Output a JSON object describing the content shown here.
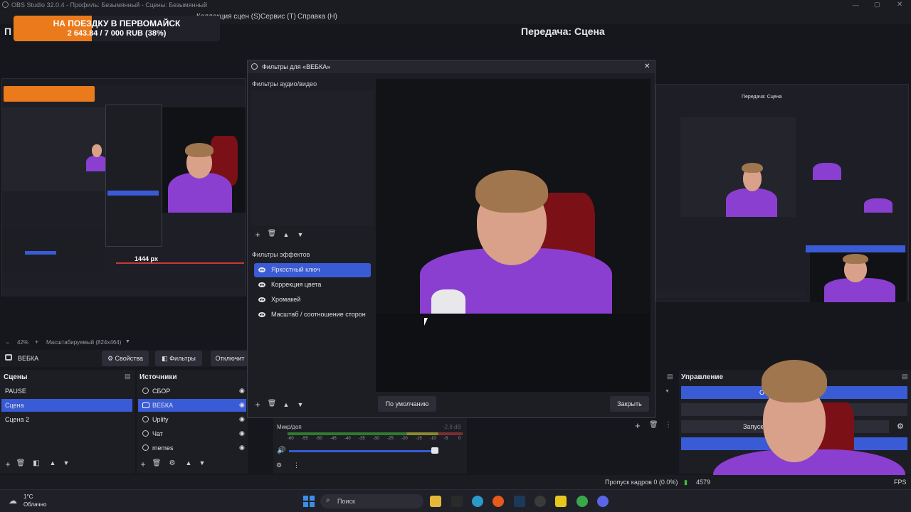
{
  "window": {
    "title": "OBS Studio 32.0.4 - Профиль: Безымянный - Сцены: Безымянный"
  },
  "menu": {
    "scenes_collection": "Коллекция сцен (S)",
    "service": "Сервис (T)",
    "help": "Справка (H)"
  },
  "donation": {
    "line1": "НА ПОЕЗДКУ В ПЕРВОМАЙСК",
    "line2": "2 643.84 / 7 000 RUB (38%)",
    "progress": 0.38
  },
  "program_title": "Передача: Сцена",
  "left_letter": "П",
  "preview_toolbar": {
    "zoom": "42%",
    "mode": "Масштабируемый (824x464)"
  },
  "source_bar": {
    "source_name": "ВЕБКА",
    "properties": "Свойства",
    "filters": "Фильтры",
    "disable": "Отключит"
  },
  "dialog": {
    "title": "Фильтры для «ВЕБКА»",
    "av_filters_label": "Фильтры аудио/видео",
    "effect_filters_label": "Фильтры эффектов",
    "effect_filters": [
      {
        "label": "Яркостный ключ",
        "selected": true
      },
      {
        "label": "Коррекция цвета",
        "selected": false
      },
      {
        "label": "Хромакей",
        "selected": false
      },
      {
        "label": "Масштаб / соотношение сторон",
        "selected": false
      }
    ],
    "default_button": "По умолчанию",
    "close_button": "Закрыть"
  },
  "scenes": {
    "header": "Сцены",
    "items": [
      {
        "label": "PAUSE",
        "selected": false
      },
      {
        "label": "Сцена",
        "selected": true
      },
      {
        "label": "Сцена 2",
        "selected": false
      }
    ]
  },
  "sources": {
    "header": "Источники",
    "items": [
      {
        "label": "СБОР",
        "selected": false
      },
      {
        "label": "ВЕБКА",
        "selected": true
      },
      {
        "label": "Uplify",
        "selected": false
      },
      {
        "label": "Чат",
        "selected": false
      },
      {
        "label": "memes",
        "selected": false
      }
    ]
  },
  "mixer": {
    "channel": "Микр/доп",
    "db": "-2.8 dB",
    "ticks": [
      "-60",
      "-55",
      "-50",
      "-45",
      "-40",
      "-35",
      "-30",
      "-25",
      "-20",
      "-15",
      "-10",
      "-5",
      "0"
    ]
  },
  "controls": {
    "header": "Управление",
    "start_prefix": "О",
    "start_recording": "Запуск"
  },
  "status": {
    "dropped_frames": "Пропуск кадров 0 (0.0%)",
    "partial": "4579",
    "fps": "FPS"
  },
  "mini_overlay": {
    "size_label": "1444 px"
  },
  "taskbar": {
    "weather_temp": "1°C",
    "weather_desc": "Облачно",
    "search": "Поиск"
  },
  "colors": {
    "accent": "#3a5bd6",
    "donation_orange": "#ea7a1c",
    "shirt": "#8a3fd0"
  }
}
